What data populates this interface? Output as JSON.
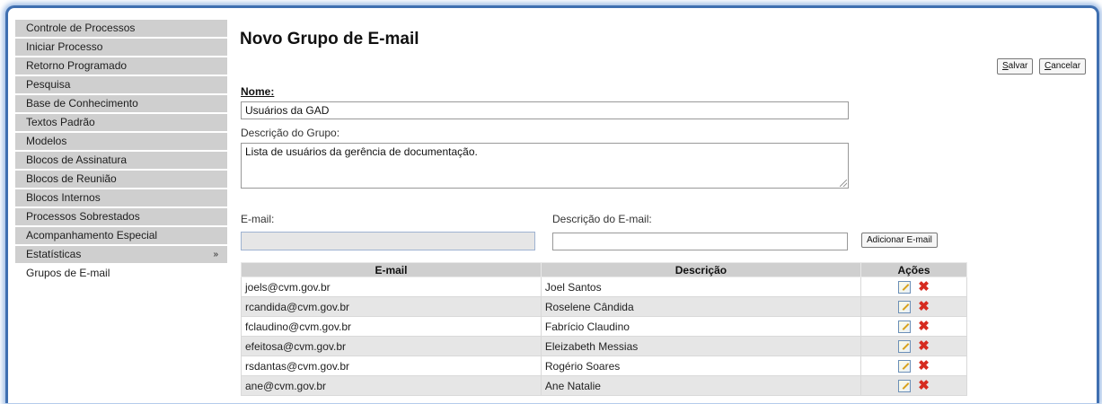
{
  "sidebar": {
    "items": [
      {
        "label": "Controle de Processos"
      },
      {
        "label": "Iniciar Processo"
      },
      {
        "label": "Retorno Programado"
      },
      {
        "label": "Pesquisa"
      },
      {
        "label": "Base de Conhecimento"
      },
      {
        "label": "Textos Padrão"
      },
      {
        "label": "Modelos"
      },
      {
        "label": "Blocos de Assinatura"
      },
      {
        "label": "Blocos de Reunião"
      },
      {
        "label": "Blocos Internos"
      },
      {
        "label": "Processos Sobrestados"
      },
      {
        "label": "Acompanhamento Especial"
      },
      {
        "label": "Estatísticas",
        "arrow": "»"
      },
      {
        "label": "Grupos de E-mail",
        "active": true
      }
    ]
  },
  "page": {
    "title": "Novo Grupo de E-mail"
  },
  "toolbar": {
    "save_label": "alvar",
    "save_key": "S",
    "cancel_label": "ancelar",
    "cancel_key": "C"
  },
  "form": {
    "nome_label": "Nome:",
    "nome_value": "Usuários da GAD",
    "descricao_label": "Descrição do Grupo:",
    "descricao_value": "Lista de usuários da gerência de documentação.",
    "email_label": "E-mail:",
    "email_value": "",
    "email_desc_label": "Descrição do E-mail:",
    "email_desc_value": "",
    "add_button_label": "Adicionar E-mail"
  },
  "table": {
    "headers": [
      "E-mail",
      "Descrição",
      "Ações"
    ],
    "rows": [
      {
        "email": "joels@cvm.gov.br",
        "descricao": "Joel Santos"
      },
      {
        "email": "rcandida@cvm.gov.br",
        "descricao": "Roselene Cândida"
      },
      {
        "email": "fclaudino@cvm.gov.br",
        "descricao": "Fabrício Claudino"
      },
      {
        "email": "efeitosa@cvm.gov.br",
        "descricao": "Eleizabeth Messias"
      },
      {
        "email": "rsdantas@cvm.gov.br",
        "descricao": "Rogério Soares"
      },
      {
        "email": "ane@cvm.gov.br",
        "descricao": "Ane Natalie"
      }
    ],
    "action_icons": [
      "edit-icon",
      "delete-icon"
    ]
  },
  "colors": {
    "frame_border": "#3f6fb0",
    "sidebar_bg": "#cfcfcf",
    "table_header_bg": "#cfcfcf",
    "row_alt_bg": "#e6e6e6",
    "delete_icon": "#d62b1f"
  }
}
